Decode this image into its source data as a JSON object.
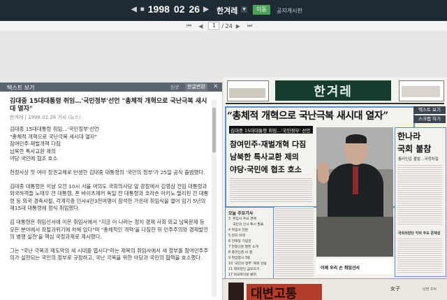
{
  "topbar": {
    "prev_icon": "triangle-left-icon",
    "year": "1998",
    "month": "02",
    "day": "26",
    "next_icon": "triangle-right-icon",
    "paper": "한겨레",
    "paper_dropdown_icon": "chevron-down-icon",
    "move_button": "이동",
    "notice_link": "공지게시판"
  },
  "pager": {
    "first_icon": "skip-first-icon",
    "prev_icon": "prev-page-icon",
    "current_page": "1",
    "total_pages": "/ 24",
    "next_icon": "next-page-icon",
    "last_icon": "skip-last-icon"
  },
  "text_panel": {
    "title": "텍스트 보기",
    "tab_original": "원문",
    "tab_convert": "한글변환",
    "close_icon": "close-icon",
    "article_title": "김대중 15대대통령 취임…'국민정부'선언 \"총체적 개혁으로 국난극복 새시대 열자\"",
    "meta": "한겨레 | 1998.02.26 기사 (뉴스)",
    "paragraphs": [
      "김대중 15대대통령 취임…'국민정부'선언\n\"총체적 개혁으로 국난극복 새시대 열자\"\n참여민주·재벌개혁 다짐\n남북한 특사교환 제의\n야당·국민에 협조 호소",
      " 헌정사상 첫 여야 정권교체로 탄생한 김대중 대통령의 '국민의 정부'가 25일 공식 출범했다.",
      " 김대중 대통령은 이날 오전 10시 서울 여의도 국회의사당 앞 광장에서 김영삼 전임 대통령과 외국하객들 노태우 전 대통령, 폰 바이츠제커 독일 전 대통령과 코라손 아키노 필리핀 전 대통령 등 외국 경축사절, 각계각층 인사4만3천여명이 참석한 가운데 취임식을 열어 임기 5년의 제15대 대통령에 정식 취임했다.",
      " 김 대통령은 취임선서에 이은 취임사에서 \"지금 이 나라는 정치 경제 사회 외교 남북문제 등 모든 분야에서 좌절과위기에 처해 있다\"며 \"총체적인 개혁'을 다짐한 뒤 민주주의와 경제발전의 병행 실천'을 핵심 국정과제로 제시했다.",
      " 그는 \"국난 극복과 재도약의 새 시대를 엽시다\"라는 제목의 취임사에서 새 정부를 참여민주주의가 실현되는 국민의 정부로 규정하고, 국난 극복을 위한 야당과 국민의 협력을 호소했다."
    ]
  },
  "newspaper": {
    "masthead": "한겨레",
    "headline": "“총체적 개혁으로 국난극복 새시대 열자”",
    "deck": "김대중 15대대통령 취임…'국민정부' 선언",
    "sub1": "참여민주·재벌개혁 다짐",
    "sub2": "남북한 특사교환 제의",
    "sub3": "야당·국민에 협조 호소",
    "photo_caption": "이제 우리 손 취임선서",
    "right_title_1": "한나라",
    "right_title_2": "국회 불참",
    "right_sub": "총리인준 불발…국정차질",
    "right_box_title": "국회의장단 각의 주도 존재성",
    "contents_title": "오늘 주요기사",
    "contents": [
      "3  취임사 주요 경제",
      "    국민의 인사 투시 발표",
      "4  취임사 전문",
      "5  현지 비데",
      "6  전태일 기념관",
      "7  한정신문 딸은 소개",
      "8  총리인준 비 결",
      "9  취임행사 3평",
      "10  ‘국민의 정부’ 해외 반응",
      "11  해외한인 금모으기",
      "17  외국학이방 밝혀",
      "19  취임식 이날아 나오며"
    ],
    "ad_text": "대변고통",
    "ad_right": "女子",
    "ad_right_2": "남현 조덕",
    "btn_text_view": "텍스트 보기",
    "btn_scrap": "스크랩 하기"
  },
  "colors": {
    "topbar_bg": "#1f2a33",
    "move_button": "#4ea35a",
    "masthead": "#173b2d",
    "highlight_border": "#5a8ed0"
  }
}
